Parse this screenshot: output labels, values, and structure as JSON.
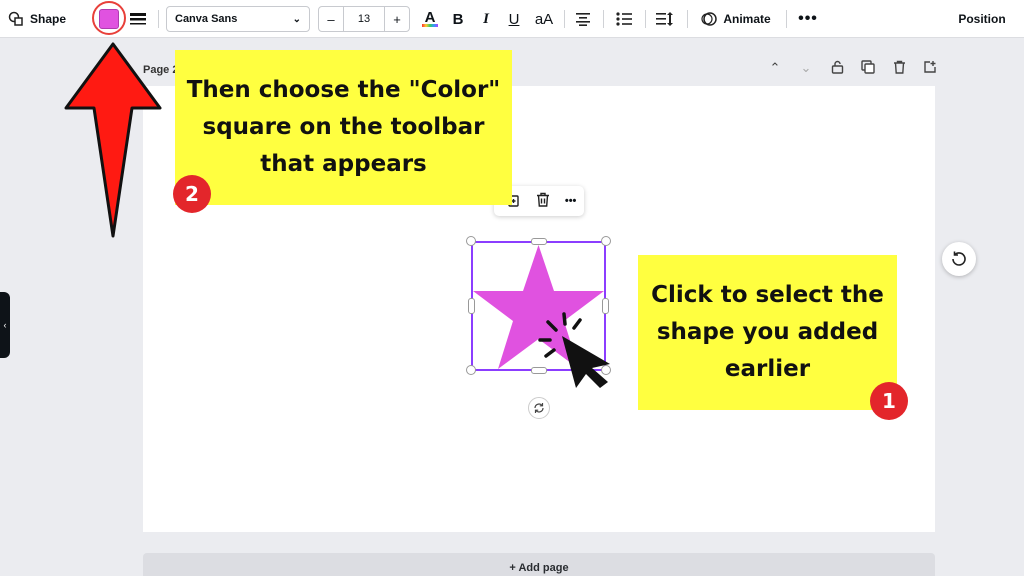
{
  "toolbar": {
    "shape_label": "Shape",
    "color_value": "#e052e0",
    "font_family_value": "Canva Sans",
    "font_size_decrease": "–",
    "font_size_value": "13",
    "font_size_increase": "+",
    "text_color_glyph": "A",
    "bold_glyph": "B",
    "italic_glyph": "I",
    "underline_glyph": "U",
    "case_glyph": "aA",
    "animate_label": "Animate",
    "more_glyph": "•••",
    "position_label": "Position"
  },
  "page": {
    "label": "Page 2",
    "add_page_label": "+ Add page"
  },
  "popover": {
    "more_glyph": "•••"
  },
  "callouts": {
    "step2_text": "Then choose the \"Color\" square on the toolbar that appears",
    "step2_number": "2",
    "step1_text": "Click to select the shape you added earlier",
    "step1_number": "1"
  },
  "colors": {
    "star_fill": "#e052e0",
    "selection_border": "#8b3dff",
    "callout_bg": "#ffff40",
    "badge_bg": "#e3262b",
    "arrow_fill": "#ff1a12"
  }
}
